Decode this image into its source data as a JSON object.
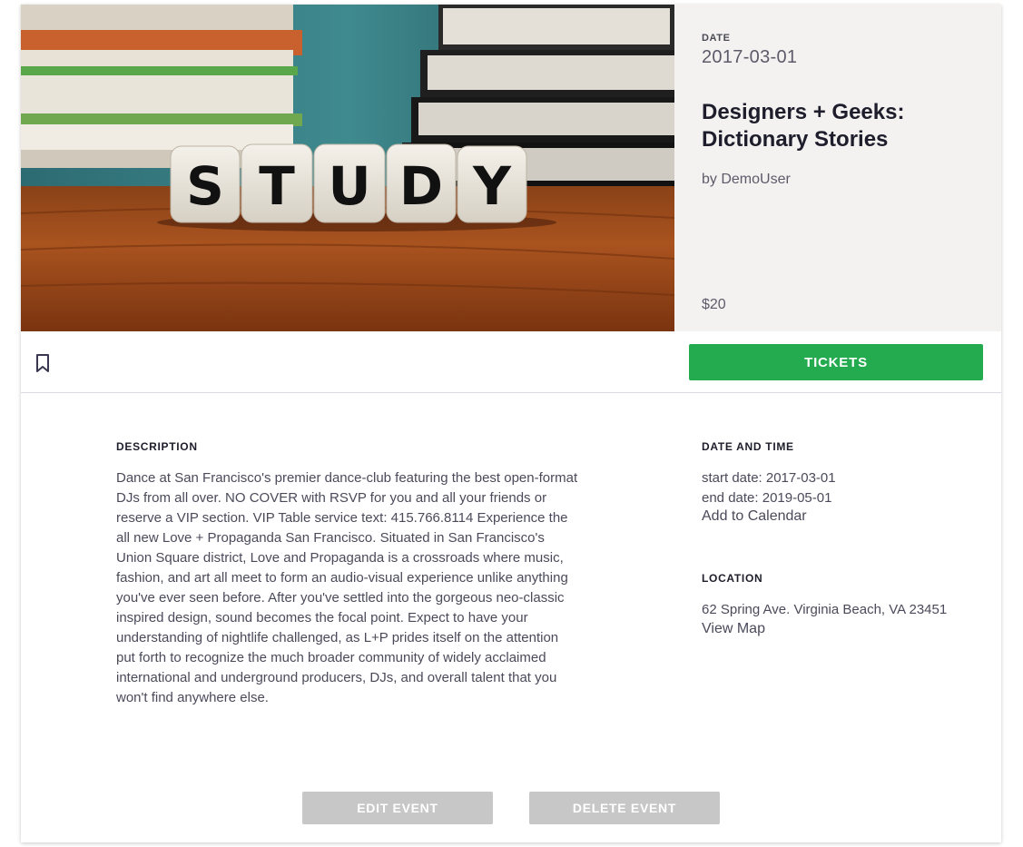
{
  "hero": {
    "image": {
      "dice_letters": [
        "S",
        "T",
        "U",
        "D",
        "Y"
      ]
    },
    "date_label": "DATE",
    "date_value": "2017-03-01",
    "title": "Designers + Geeks: Dictionary Stories",
    "author": "by DemoUser",
    "price": "$20"
  },
  "actions": {
    "bookmark_icon": "bookmark-icon",
    "tickets_label": "TICKETS",
    "tickets_color": "#24ab4f"
  },
  "description": {
    "heading": "DESCRIPTION",
    "text": "Dance at San Francisco's premier dance-club featuring the best open-format DJs from all over. NO COVER with RSVP for you and all your friends or reserve a VIP section. VIP Table service text: 415.766.8114 Experience the all new Love + Propaganda San Francisco. Situated in San Francisco's Union Square district, Love and Propaganda is a crossroads where music, fashion, and art all meet to form an audio-visual experience unlike anything you've ever seen before. After you've settled into the gorgeous neo-classic inspired design, sound becomes the focal point. Expect to have your understanding of nightlife challenged, as L+P prides itself on the attention put forth to recognize the much broader community of widely acclaimed international and underground producers, DJs, and overall talent that you won't find anywhere else."
  },
  "datetime": {
    "heading": "DATE AND TIME",
    "start": "start date: 2017-03-01",
    "end": "end date: 2019-05-01",
    "calendar_link": "Add to Calendar"
  },
  "location": {
    "heading": "LOCATION",
    "address": "62 Spring Ave. Virginia Beach, VA 23451",
    "map_link": "View Map"
  },
  "footer": {
    "edit_label": "EDIT EVENT",
    "delete_label": "DELETE EVENT"
  }
}
